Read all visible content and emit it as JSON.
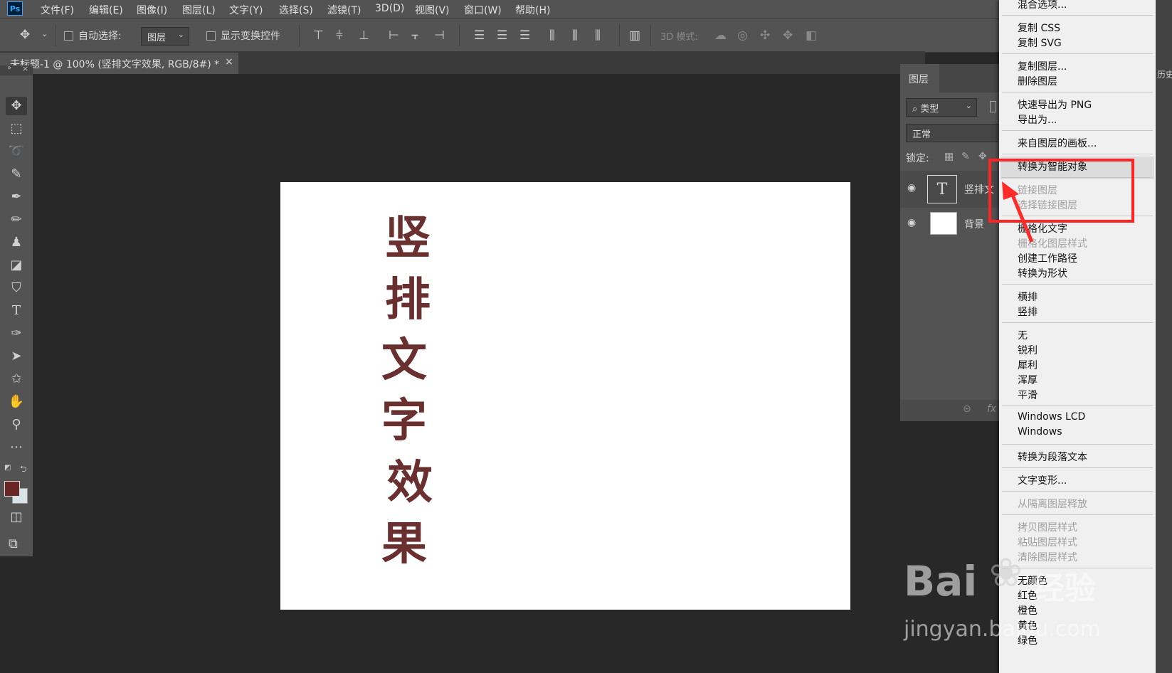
{
  "app": {
    "logo": "Ps"
  },
  "menubar": {
    "items": [
      "文件(F)",
      "编辑(E)",
      "图像(I)",
      "图层(L)",
      "文字(Y)",
      "选择(S)",
      "滤镜(T)",
      "3D(D)",
      "视图(V)",
      "窗口(W)",
      "帮助(H)"
    ]
  },
  "options": {
    "auto_select_label": "自动选择:",
    "auto_select_value": "图层",
    "show_transform_label": "显示变换控件",
    "mode_3d_label": "3D 模式:"
  },
  "document": {
    "tab_title": "未标题-1 @ 100% (竖排文字效果, RGB/8#) *",
    "tab_close": "×",
    "vertical_text": [
      "竖",
      "排",
      "文",
      "字",
      "效",
      "果"
    ],
    "text_color": "#6a2f2f"
  },
  "toolbox": {
    "foreground_color": "#6a2525",
    "background_color": "#d8e4ea"
  },
  "layers_panel": {
    "tab_label": "图层",
    "filter_value": "类型",
    "blend_mode": "正常",
    "lock_label": "锁定:",
    "layers": [
      {
        "name": "竖排文",
        "thumb": "T",
        "visible_icon": "eye-icon"
      },
      {
        "name": "背景",
        "thumb": "",
        "visible_icon": "eye-icon"
      }
    ],
    "side_text": "历史"
  },
  "context_menu": {
    "groups": [
      [
        {
          "label": "混合选项...",
          "enabled": true
        }
      ],
      [
        {
          "label": "复制 CSS",
          "enabled": true
        },
        {
          "label": "复制 SVG",
          "enabled": true
        }
      ],
      [
        {
          "label": "复制图层...",
          "enabled": true
        },
        {
          "label": "删除图层",
          "enabled": true
        }
      ],
      [
        {
          "label": "快速导出为 PNG",
          "enabled": true
        },
        {
          "label": "导出为...",
          "enabled": true
        }
      ],
      [
        {
          "label": "来自图层的画板...",
          "enabled": true
        }
      ],
      [
        {
          "label": "转换为智能对象",
          "enabled": true
        }
      ],
      [
        {
          "label": "链接图层",
          "enabled": false
        },
        {
          "label": "选择链接图层",
          "enabled": false
        }
      ],
      [
        {
          "label": "栅格化文字",
          "enabled": true
        },
        {
          "label": "栅格化图层样式",
          "enabled": false
        },
        {
          "label": "创建工作路径",
          "enabled": true
        },
        {
          "label": "转换为形状",
          "enabled": true
        }
      ],
      [
        {
          "label": "横排",
          "enabled": true
        },
        {
          "label": "竖排",
          "enabled": true
        }
      ],
      [
        {
          "label": "无",
          "enabled": true
        },
        {
          "label": "锐利",
          "enabled": true
        },
        {
          "label": "犀利",
          "enabled": true
        },
        {
          "label": "浑厚",
          "enabled": true
        },
        {
          "label": "平滑",
          "enabled": true
        }
      ],
      [
        {
          "label": "Windows LCD",
          "enabled": true
        },
        {
          "label": "Windows",
          "enabled": true
        }
      ],
      [
        {
          "label": "转换为段落文本",
          "enabled": true
        }
      ],
      [
        {
          "label": "文字变形...",
          "enabled": true
        }
      ],
      [
        {
          "label": "从隔离图层释放",
          "enabled": false
        }
      ],
      [
        {
          "label": "拷贝图层样式",
          "enabled": false
        },
        {
          "label": "粘贴图层样式",
          "enabled": false
        },
        {
          "label": "清除图层样式",
          "enabled": false
        }
      ],
      [
        {
          "label": "无颜色",
          "enabled": true
        },
        {
          "label": "红色",
          "enabled": true
        },
        {
          "label": "橙色",
          "enabled": true
        },
        {
          "label": "黄色",
          "enabled": true
        },
        {
          "label": "绿色",
          "enabled": true
        }
      ]
    ]
  },
  "watermark": {
    "brand": "Bai",
    "brand_cn": "经验",
    "url": "jingyan.baidu.com"
  },
  "annotation": {
    "highlight_color": "#ff2424"
  }
}
